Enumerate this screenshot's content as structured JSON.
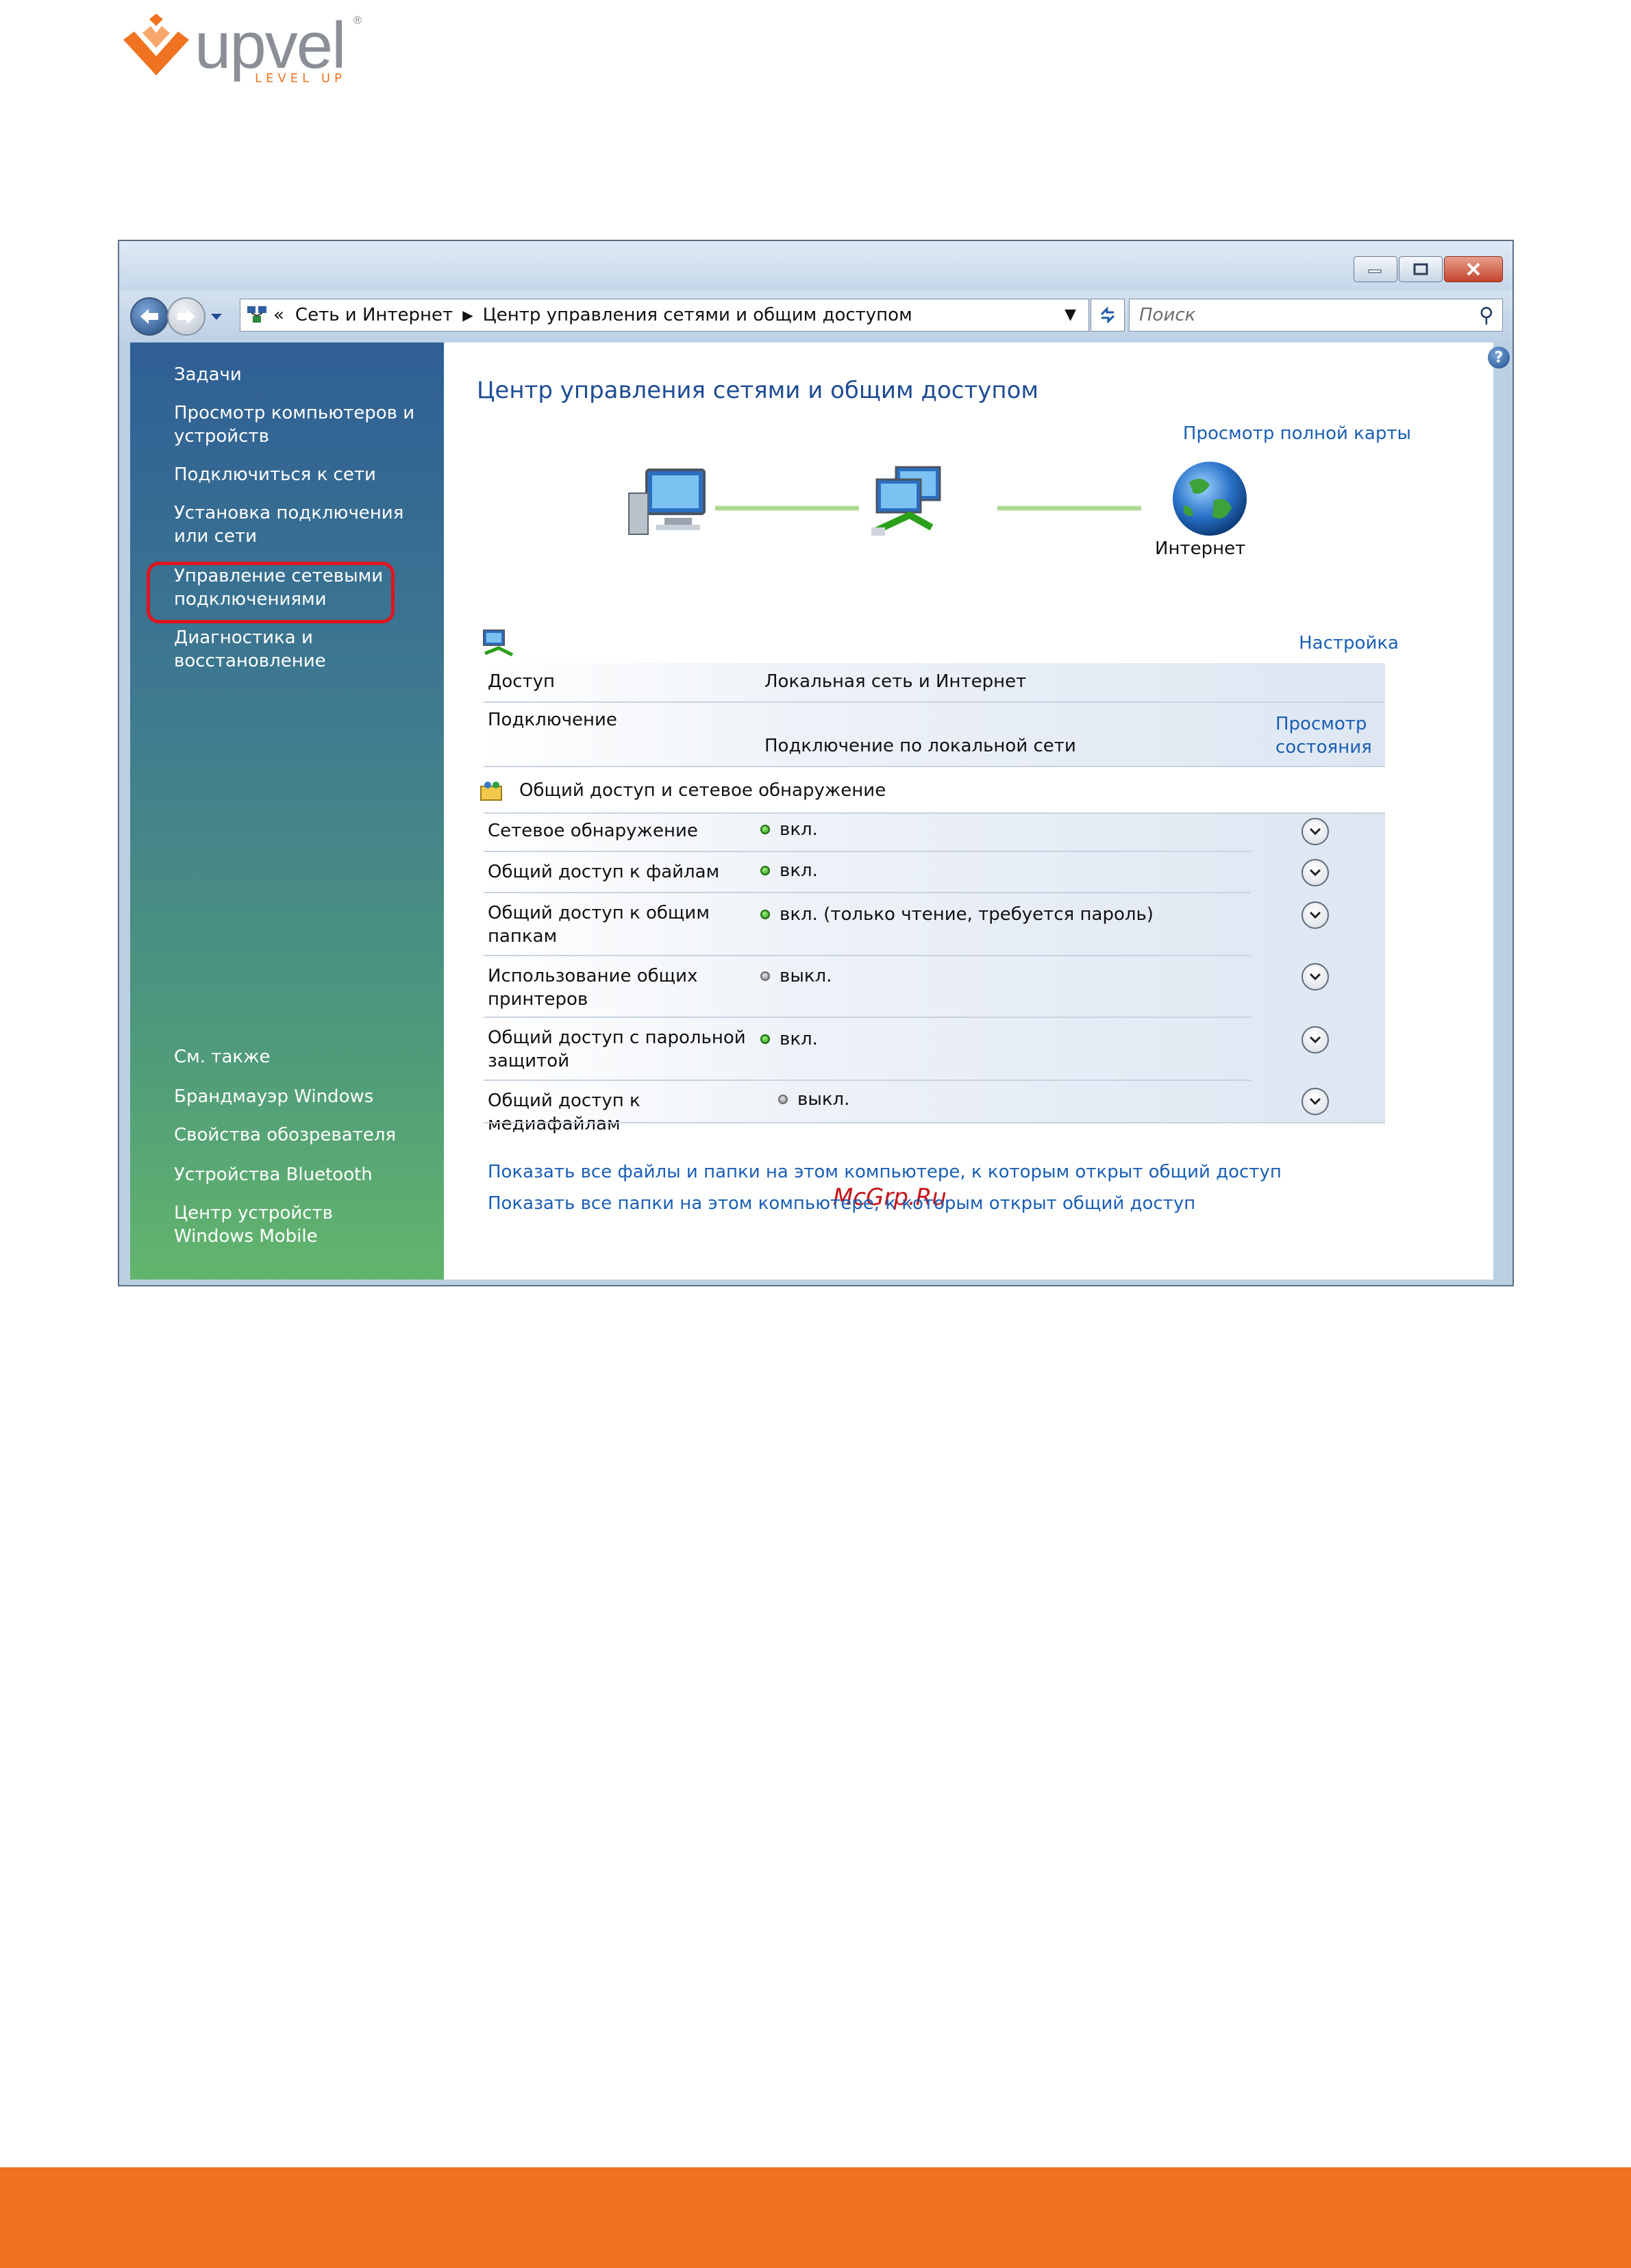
{
  "brand": {
    "name": "upvel",
    "tagline": "LEVEL UP",
    "registered_mark": "®",
    "accent_color": "#f07321",
    "gray_color": "#8a8f96"
  },
  "window": {
    "nav": {
      "back_icon": "arrow-left-icon",
      "forward_icon": "arrow-right-icon"
    },
    "address": {
      "root_marker": "«",
      "crumbs": [
        "Сеть и Интернет",
        "Центр управления сетями и общим доступом"
      ]
    },
    "search": {
      "placeholder": "Поиск"
    }
  },
  "sidebar": {
    "tasks_heading": "Задачи",
    "tasks": [
      "Просмотр компьютеров и устройств",
      "Подключиться к сети",
      "Установка подключения или сети",
      "Управление сетевыми подключениями",
      "Диагностика и восстановление"
    ],
    "see_also_heading": "См. также",
    "see_also": [
      "Брандмауэр Windows",
      "Свойства обозревателя",
      "Устройства Bluetooth",
      "Центр устройств Windows Mobile"
    ]
  },
  "main": {
    "title": "Центр управления сетями и общим доступом",
    "full_map_link": "Просмотр полной карты",
    "internet_label": "Интернет",
    "network": {
      "customize_link": "Настройка",
      "rows": [
        {
          "label": "Доступ",
          "value": "Локальная сеть и Интернет"
        },
        {
          "label": "Подключение",
          "value": "Подключение по локальной сети"
        }
      ],
      "status_link": "Просмотр состояния"
    },
    "sharing": {
      "title": "Общий доступ и сетевое обнаружение",
      "rows": [
        {
          "label": "Сетевое обнаружение",
          "value": "вкл.",
          "on": true
        },
        {
          "label": "Общий доступ к файлам",
          "value": "вкл.",
          "on": true
        },
        {
          "label": "Общий доступ к общим папкам",
          "value": "вкл. (только чтение, требуется пароль)",
          "on": true
        },
        {
          "label": "Использование общих принтеров",
          "value": "выкл.",
          "on": false
        },
        {
          "label": "Общий доступ с парольной защитой",
          "value": "вкл.",
          "on": true
        },
        {
          "label": "Общий доступ к медиафайлам",
          "value": "выкл.",
          "on": false
        }
      ]
    },
    "bottom_links": [
      "Показать все файлы и папки на этом компьютере, к которым открыт общий доступ",
      "Показать все папки на этом компьютере, к которым открыт общий доступ"
    ]
  },
  "watermark": "McGrp.Ru"
}
